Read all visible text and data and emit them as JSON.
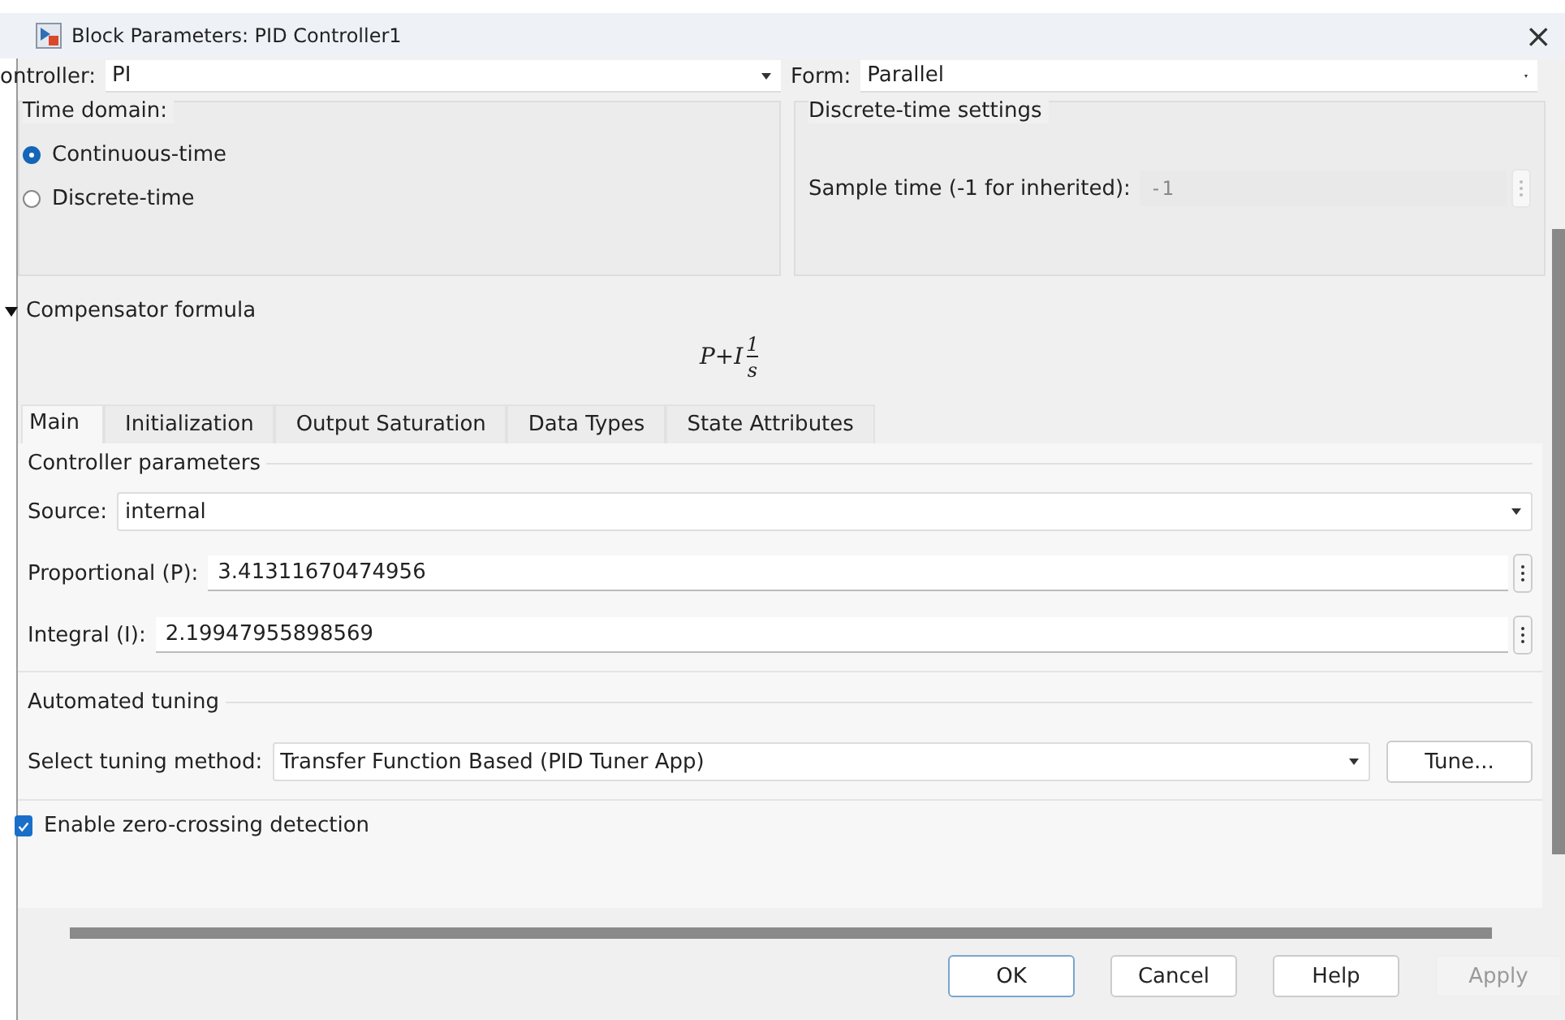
{
  "window": {
    "title": "Block Parameters: PID Controller1",
    "close": "×"
  },
  "controller": {
    "label": "ontroller:",
    "value": "PI"
  },
  "form": {
    "label": "Form:",
    "value": "Parallel"
  },
  "time_domain": {
    "title": "Time domain:",
    "options": [
      {
        "label": "Continuous-time",
        "selected": true
      },
      {
        "label": "Discrete-time",
        "selected": false
      }
    ]
  },
  "discrete_settings": {
    "title": "Discrete-time settings",
    "label": "Sample time (-1 for inherited):",
    "value": "-1",
    "disabled": true
  },
  "compensator": {
    "label": "Compensator formula",
    "expanded": true,
    "formula": {
      "left": "P+I",
      "numerator": "1",
      "denominator": "s"
    }
  },
  "tabs": [
    {
      "label": "Main",
      "selected": true
    },
    {
      "label": "Initialization",
      "selected": false
    },
    {
      "label": "Output Saturation",
      "selected": false
    },
    {
      "label": "Data Types",
      "selected": false
    },
    {
      "label": "State Attributes",
      "selected": false
    }
  ],
  "controller_parameters": {
    "title": "Controller parameters",
    "source": {
      "label": "Source:",
      "value": "internal"
    },
    "params": [
      {
        "label": "Proportional (P):",
        "value": "3.41311670474956"
      },
      {
        "label": "Integral (I):",
        "value": "2.19947955898569"
      }
    ]
  },
  "automated_tuning": {
    "title": "Automated tuning",
    "label": "Select tuning method:",
    "value": "Transfer Function Based (PID Tuner App)",
    "button": "Tune..."
  },
  "zero_crossing": {
    "label": "Enable zero-crossing detection",
    "checked": true
  },
  "buttons": [
    {
      "label": "OK",
      "kind": "default",
      "disabled": false
    },
    {
      "label": "Cancel",
      "kind": "normal",
      "disabled": false
    },
    {
      "label": "Help",
      "kind": "normal",
      "disabled": false
    },
    {
      "label": "Apply",
      "kind": "normal",
      "disabled": true
    }
  ]
}
